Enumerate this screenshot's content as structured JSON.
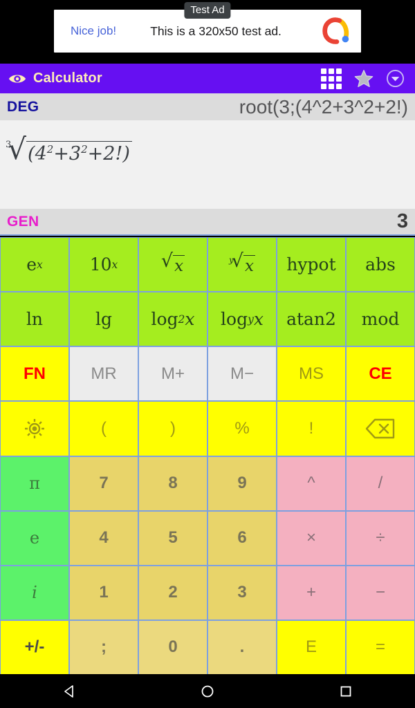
{
  "ad": {
    "badge": "Test Ad",
    "cta": "Nice job!",
    "body": "This is a 320x50 test ad.",
    "logo_icon": "admob-logo-icon"
  },
  "titlebar": {
    "title": "Calculator",
    "eye_icon": "eye-icon",
    "grid_icon": "grid-icon",
    "star_icon": "star-icon",
    "chevron_icon": "chevron-down-circle-icon",
    "background": "#6610f2",
    "title_color": "#ffeeb8"
  },
  "display": {
    "angle_mode": "DEG",
    "angle_mode_color": "#15129e",
    "expression": "root(3;(4^2+3^2+2!)",
    "pretty": {
      "root_index": "3",
      "radicand_open": "(4",
      "radicand_exp1": "2",
      "radicand_mid": "+3",
      "radicand_exp2": "2",
      "radicand_tail": "+2!)"
    },
    "number_mode": "GEN",
    "number_mode_color": "#e81ecb",
    "result": "3"
  },
  "keypad": {
    "rows": [
      [
        {
          "name": "key-exp-e",
          "label": "e",
          "sup": "x",
          "style": "k-green"
        },
        {
          "name": "key-exp-10",
          "label": "10",
          "sup": "x",
          "style": "k-green"
        },
        {
          "name": "key-sqrt",
          "label": "sqrt",
          "style": "k-green"
        },
        {
          "name": "key-nth-root",
          "label": "yroot",
          "style": "k-green"
        },
        {
          "name": "key-hypot",
          "label": "hypot",
          "style": "k-green"
        },
        {
          "name": "key-abs",
          "label": "abs",
          "style": "k-green"
        }
      ],
      [
        {
          "name": "key-ln",
          "label": "ln",
          "style": "k-green"
        },
        {
          "name": "key-lg",
          "label": "lg",
          "style": "k-green"
        },
        {
          "name": "key-log2",
          "label": "log",
          "sub": "2",
          "tail": "x",
          "style": "k-green"
        },
        {
          "name": "key-logy",
          "label": "log",
          "sub": "y",
          "tail": "x",
          "style": "k-green"
        },
        {
          "name": "key-atan2",
          "label": "atan2",
          "style": "k-green"
        },
        {
          "name": "key-mod",
          "label": "mod",
          "style": "k-green"
        }
      ],
      [
        {
          "name": "key-fn",
          "label": "FN",
          "style": "k-yellow",
          "text": "t-red"
        },
        {
          "name": "key-mr",
          "label": "MR",
          "style": "k-gray"
        },
        {
          "name": "key-m-plus",
          "label": "M+",
          "style": "k-gray"
        },
        {
          "name": "key-m-minus",
          "label": "M−",
          "style": "k-gray"
        },
        {
          "name": "key-ms",
          "label": "MS",
          "style": "k-yellow",
          "text": "t-olive"
        },
        {
          "name": "key-ce",
          "label": "CE",
          "style": "k-yellow",
          "text": "t-red"
        }
      ],
      [
        {
          "name": "key-settings",
          "label": "",
          "icon": "gear-icon",
          "style": "k-yellow"
        },
        {
          "name": "key-paren-open",
          "label": "(",
          "style": "k-yellow",
          "text": "t-olive"
        },
        {
          "name": "key-paren-close",
          "label": ")",
          "style": "k-yellow",
          "text": "t-olive"
        },
        {
          "name": "key-percent",
          "label": "%",
          "style": "k-yellow",
          "text": "t-olive"
        },
        {
          "name": "key-factorial",
          "label": "!",
          "style": "k-yellow",
          "text": "t-olive"
        },
        {
          "name": "key-backspace",
          "label": "",
          "icon": "backspace-icon",
          "style": "k-yellow"
        }
      ],
      [
        {
          "name": "key-pi",
          "label": "π",
          "style": "k-mint",
          "serif": true
        },
        {
          "name": "key-7",
          "label": "7",
          "style": "k-khaki"
        },
        {
          "name": "key-8",
          "label": "8",
          "style": "k-khaki"
        },
        {
          "name": "key-9",
          "label": "9",
          "style": "k-khaki"
        },
        {
          "name": "key-power",
          "label": "^",
          "style": "k-pink"
        },
        {
          "name": "key-slash",
          "label": "/",
          "style": "k-pink"
        }
      ],
      [
        {
          "name": "key-euler-e",
          "label": "e",
          "style": "k-mint",
          "serif": true
        },
        {
          "name": "key-4",
          "label": "4",
          "style": "k-khaki"
        },
        {
          "name": "key-5",
          "label": "5",
          "style": "k-khaki"
        },
        {
          "name": "key-6",
          "label": "6",
          "style": "k-khaki"
        },
        {
          "name": "key-multiply",
          "label": "×",
          "style": "k-pink"
        },
        {
          "name": "key-divide",
          "label": "÷",
          "style": "k-pink"
        }
      ],
      [
        {
          "name": "key-imaginary",
          "label": "i",
          "style": "k-mint",
          "serif": true,
          "italic": true
        },
        {
          "name": "key-1",
          "label": "1",
          "style": "k-khaki"
        },
        {
          "name": "key-2",
          "label": "2",
          "style": "k-khaki"
        },
        {
          "name": "key-3",
          "label": "3",
          "style": "k-khaki"
        },
        {
          "name": "key-plus",
          "label": "+",
          "style": "k-pink"
        },
        {
          "name": "key-minus",
          "label": "−",
          "style": "k-pink"
        }
      ],
      [
        {
          "name": "key-sign",
          "label": "+/-",
          "style": "k-yellow",
          "text": "t-dark"
        },
        {
          "name": "key-semicolon",
          "label": ";",
          "style": "k-khaki2"
        },
        {
          "name": "key-0",
          "label": "0",
          "style": "k-khaki2"
        },
        {
          "name": "key-decimal",
          "label": ".",
          "style": "k-khaki2"
        },
        {
          "name": "key-exponent",
          "label": "E",
          "style": "k-yellow",
          "text": "t-olive"
        },
        {
          "name": "key-equals",
          "label": "=",
          "style": "k-yellow",
          "text": "t-olive"
        }
      ]
    ]
  },
  "navbar": {
    "back_icon": "back-triangle-icon",
    "home_icon": "home-circle-icon",
    "recents_icon": "recents-square-icon"
  }
}
